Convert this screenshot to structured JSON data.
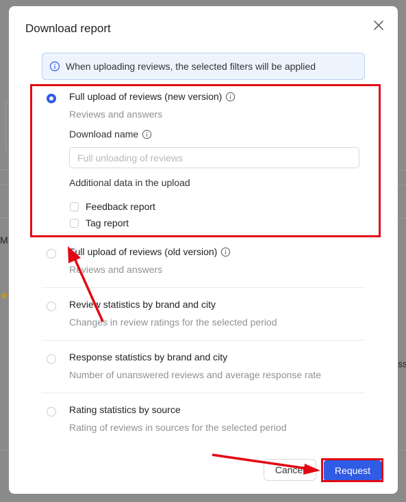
{
  "background": {
    "left_letter": "M",
    "right_letter": "ss"
  },
  "modal": {
    "title": "Download report",
    "info_banner": "When uploading reviews, the selected filters will be applied",
    "options": [
      {
        "title": "Full upload of reviews (new version)",
        "description": "Reviews and answers",
        "selected": true,
        "has_info_icon": true
      },
      {
        "title": "Full upload of reviews (old version)",
        "description": "Reviews and answers",
        "selected": false,
        "has_info_icon": true
      },
      {
        "title": "Review statistics by brand and city",
        "description": "Changes in review ratings for the selected period",
        "selected": false,
        "has_info_icon": false
      },
      {
        "title": "Response statistics by brand and city",
        "description": "Number of unanswered reviews and average response rate",
        "selected": false,
        "has_info_icon": false
      },
      {
        "title": "Rating statistics by source",
        "description": "Rating of reviews in sources for the selected period",
        "selected": false,
        "has_info_icon": false
      }
    ],
    "download_name_label": "Download name",
    "download_name_placeholder": "Full unloading of reviews",
    "download_name_value": "",
    "additional_data_label": "Additional data in the upload",
    "checkboxes": [
      {
        "label": "Feedback report",
        "checked": false
      },
      {
        "label": "Tag report",
        "checked": false
      }
    ],
    "cancel_label": "Cancel",
    "request_label": "Request"
  },
  "colors": {
    "primary": "#2f5be5",
    "annotation": "#e30613",
    "info_bg": "#eef4fd"
  },
  "icons": {
    "close": "close-icon",
    "info": "info-circle-icon",
    "question": "info-circle-icon"
  }
}
